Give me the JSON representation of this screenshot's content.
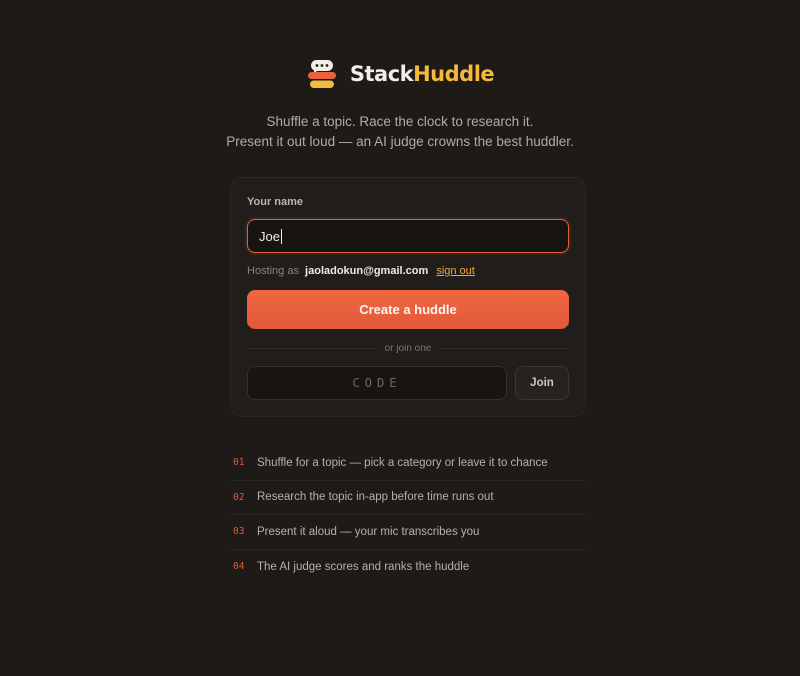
{
  "brand": {
    "name_part1": "Stack",
    "name_part2": "Huddle",
    "colors": {
      "primary": "#f3ede7",
      "accent": "#f5b93b",
      "logo_top": "#f3ede7",
      "logo_mid": "#e9603d",
      "logo_bottom": "#f5b93b"
    }
  },
  "tagline": {
    "line1": "Shuffle a topic. Race the clock to research it.",
    "line2": "Present it out loud — an AI judge crowns the best huddler."
  },
  "form": {
    "name_label": "Your name",
    "name_value": "Joe",
    "hosting_prefix": "Hosting as",
    "hosting_email": "jaoladokun@gmail.com",
    "sign_out_label": "sign out",
    "create_label": "Create a huddle",
    "divider_text": "or join one",
    "code_placeholder": "CODE",
    "join_label": "Join"
  },
  "steps": [
    {
      "num": "01",
      "text": "Shuffle for a topic — pick a category or leave it to chance"
    },
    {
      "num": "02",
      "text": "Research the topic in-app before time runs out"
    },
    {
      "num": "03",
      "text": "Present it aloud — your mic transcribes you"
    },
    {
      "num": "04",
      "text": "The AI judge scores and ranks the huddle"
    }
  ],
  "colors": {
    "background": "#1d1a18",
    "button": "#e9603d",
    "step_number": "#e25a3a"
  }
}
